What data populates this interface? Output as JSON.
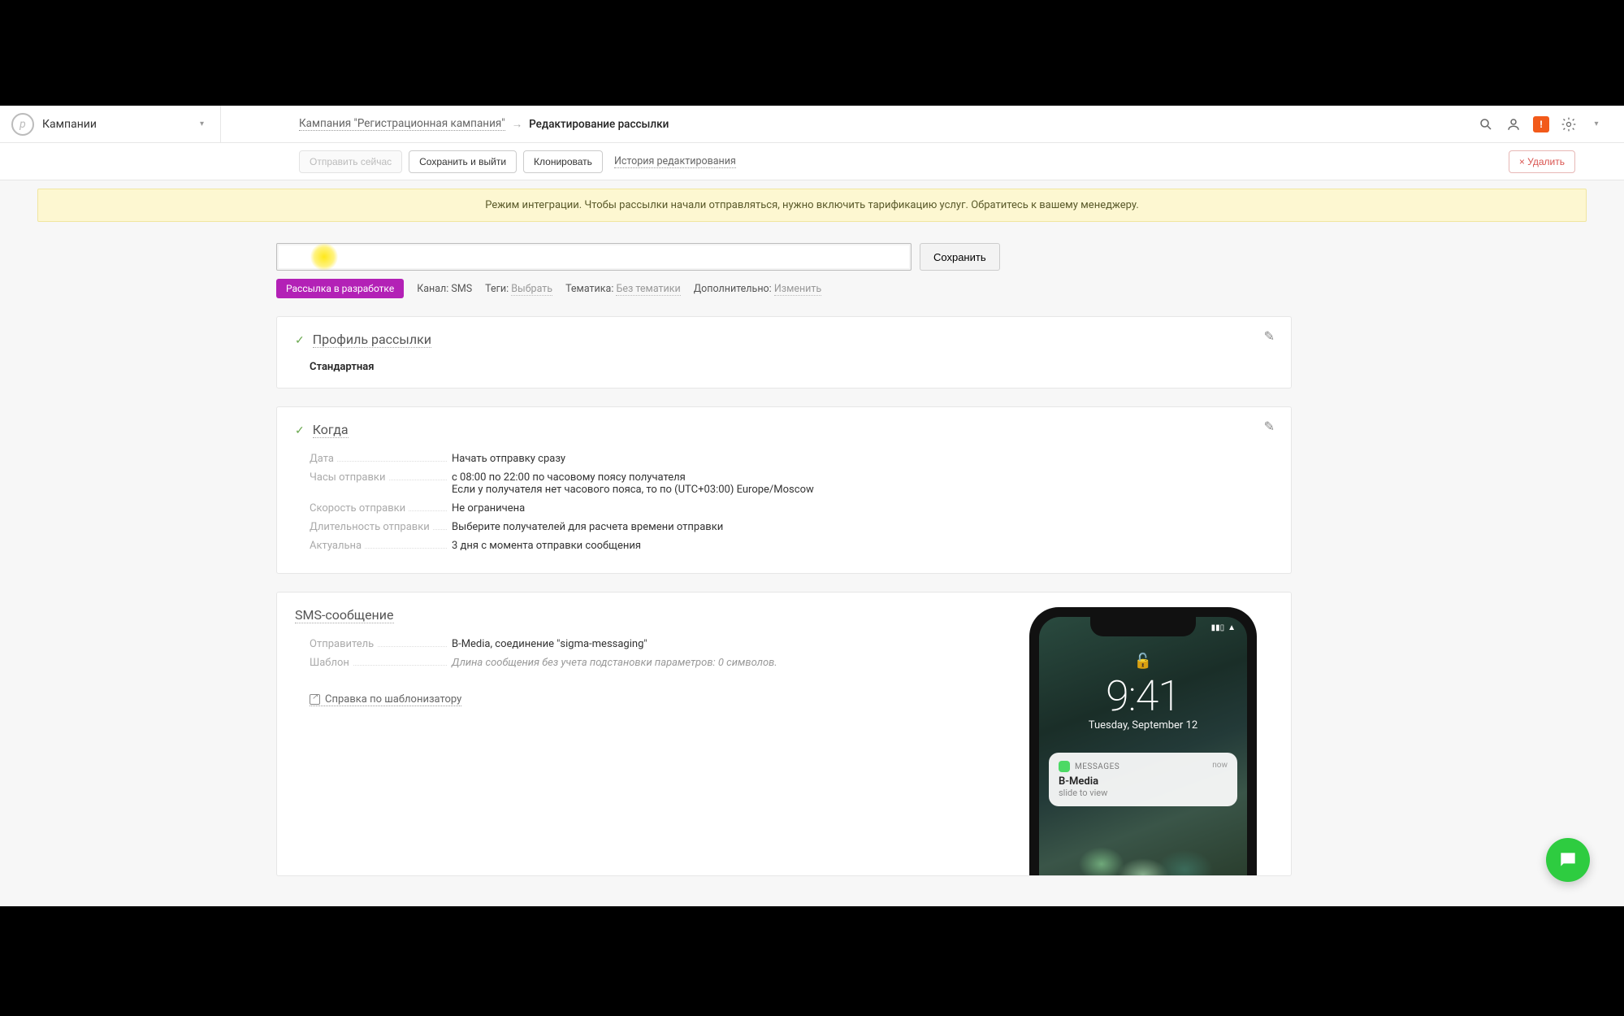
{
  "brand": {
    "name": "Кампании"
  },
  "breadcrumb": {
    "parent": "Кампания \"Регистрационная кампания\"",
    "current": "Редактирование рассылки"
  },
  "actions": {
    "send_now": "Отправить сейчас",
    "save_exit": "Сохранить и выйти",
    "clone": "Клонировать",
    "history": "История редактирования",
    "delete": "× Удалить"
  },
  "notice": "Режим интеграции. Чтобы рассылки начали отправляться, нужно включить тарификацию услуг. Обратитесь к вашему менеджеру.",
  "title_input": {
    "value": "",
    "placeholder": ""
  },
  "save_btn": "Сохранить",
  "meta": {
    "status_badge": "Рассылка в разработке",
    "channel_label": "Канал:",
    "channel_value": "SMS",
    "tags_label": "Теги:",
    "tags_action": "Выбрать",
    "topic_label": "Тематика:",
    "topic_value": "Без тематики",
    "extra_label": "Дополнительно:",
    "extra_action": "Изменить"
  },
  "profile": {
    "title": "Профиль рассылки",
    "value": "Стандартная"
  },
  "when": {
    "title": "Когда",
    "rows": {
      "date": {
        "k": "Дата",
        "v": "Начать отправку сразу"
      },
      "hours": {
        "k": "Часы отправки",
        "v": "с 08:00 по 22:00 по часовому поясу получателя",
        "v2": "Если у получателя нет часового пояса, то по (UTC+03:00) Europe/Moscow"
      },
      "speed": {
        "k": "Скорость отправки",
        "v": "Не ограничена"
      },
      "duration": {
        "k": "Длительность отправки",
        "v": "Выберите получателей для расчета времени отправки"
      },
      "actual": {
        "k": "Актуальна",
        "v": "3 дня с момента отправки сообщения"
      }
    }
  },
  "sms": {
    "title": "SMS-сообщение",
    "sender_k": "Отправитель",
    "sender_v": "B-Media, соединение \"sigma-messaging\"",
    "template_k": "Шаблон",
    "template_hint": "Длина сообщения без учета подстановки параметров: 0 символов.",
    "help": "Справка по шаблонизатору"
  },
  "phone": {
    "time": "9:41",
    "date": "Tuesday, September 12",
    "notif_app": "MESSAGES",
    "notif_now": "now",
    "notif_title": "B-Media",
    "notif_sub": "slide to view"
  }
}
